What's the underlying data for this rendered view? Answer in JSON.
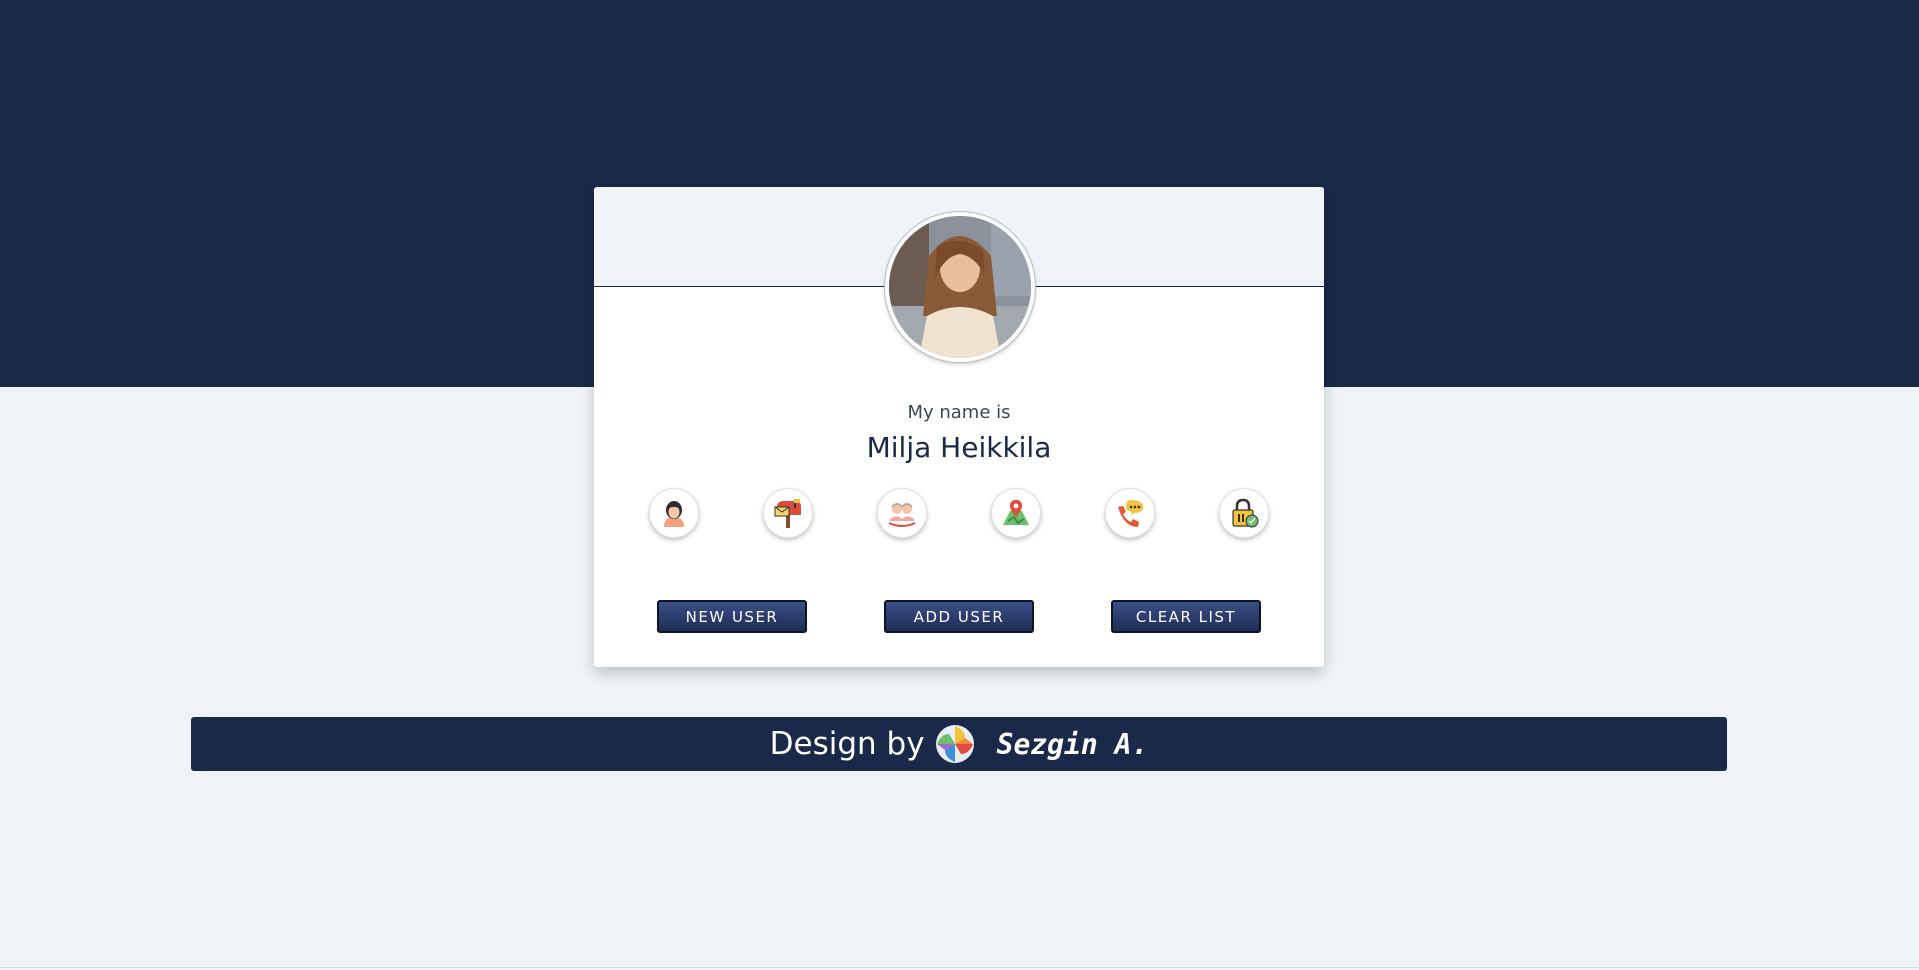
{
  "profile": {
    "label": "My name is",
    "name": "Milja Heikkila",
    "avatar_alt": "Milja Heikkila"
  },
  "icons": [
    {
      "name": "user-icon",
      "tooltip": "name"
    },
    {
      "name": "mailbox-icon",
      "tooltip": "email"
    },
    {
      "name": "age-icon",
      "tooltip": "age"
    },
    {
      "name": "map-icon",
      "tooltip": "location"
    },
    {
      "name": "phone-icon",
      "tooltip": "phone"
    },
    {
      "name": "padlock-icon",
      "tooltip": "password"
    }
  ],
  "buttons": {
    "new_user": "NEW USER",
    "add_user": "ADD USER",
    "clear_list": "CLEAR LIST"
  },
  "footer": {
    "design_by": "Design by",
    "author": "Sezgin A."
  },
  "colors": {
    "primary": "#1a2849",
    "background": "#f0f4f8",
    "button_top": "#3a4f86",
    "button_bottom": "#1e2d55"
  }
}
